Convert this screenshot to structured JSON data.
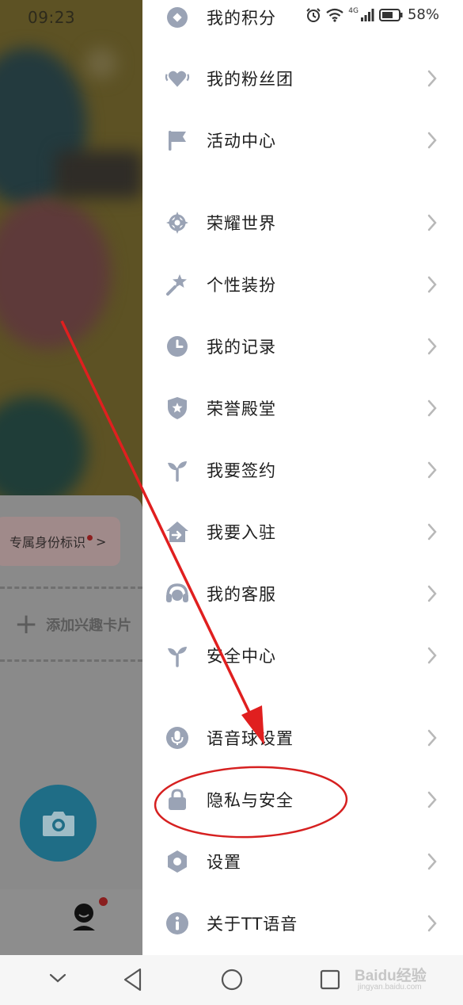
{
  "status_bar": {
    "time": "09:23",
    "network": "4G",
    "battery": "58%"
  },
  "background_app": {
    "identity_tag": "专属身份标识",
    "identity_tag_chevron": ">",
    "add_interest": "添加兴趣卡片",
    "add_interest_plus": "+"
  },
  "menu": {
    "items": [
      {
        "label": "我的积分",
        "icon": "points-icon"
      },
      {
        "label": "我的粉丝团",
        "icon": "fan-club-icon"
      },
      {
        "label": "活动中心",
        "icon": "flag-icon"
      },
      {
        "label": "荣耀世界",
        "icon": "compass-star-icon"
      },
      {
        "label": "个性装扮",
        "icon": "magic-wand-icon"
      },
      {
        "label": "我的记录",
        "icon": "clock-icon"
      },
      {
        "label": "荣誉殿堂",
        "icon": "shield-star-icon"
      },
      {
        "label": "我要签约",
        "icon": "sprout-icon"
      },
      {
        "label": "我要入驻",
        "icon": "house-arrow-icon"
      },
      {
        "label": "我的客服",
        "icon": "headset-icon"
      },
      {
        "label": "安全中心",
        "icon": "sprout-icon"
      },
      {
        "label": "语音球设置",
        "icon": "microphone-icon"
      },
      {
        "label": "隐私与安全",
        "icon": "lock-icon"
      },
      {
        "label": "设置",
        "icon": "gear-icon"
      },
      {
        "label": "关于TT语音",
        "icon": "info-icon"
      }
    ]
  },
  "watermark": {
    "brand": "Baidu经验",
    "url": "jingyan.baidu.com"
  },
  "colors": {
    "icon": "#9aa3b5",
    "annotation_red": "#e01f1f",
    "text": "#1f1f1f",
    "chevron": "#b8b8b8"
  }
}
